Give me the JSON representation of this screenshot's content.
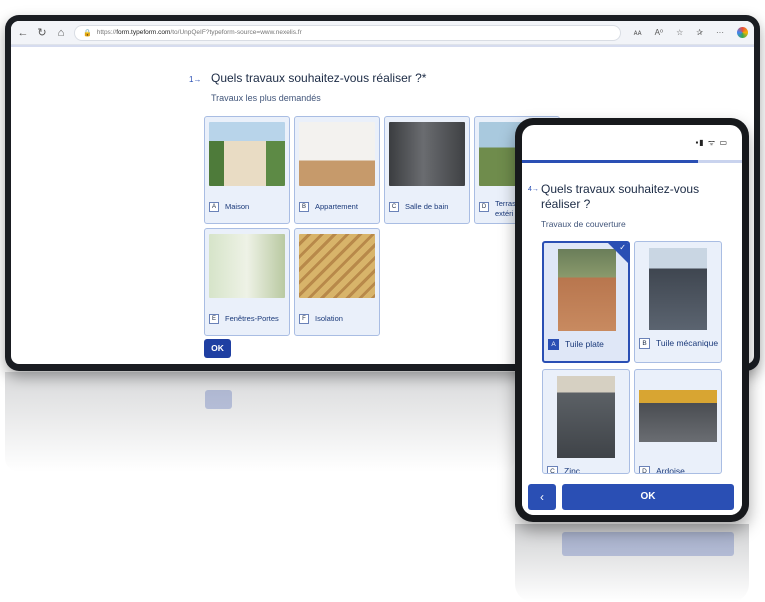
{
  "browser": {
    "url_prefix": "https://",
    "url_host": "form.typeform.com",
    "url_rest": "/to/UnpQeIF?typeform-source=www.nexelis.fr",
    "toolbar_icons": [
      "back-icon",
      "reload-icon",
      "home-icon",
      "lock-icon"
    ],
    "right_icons": [
      "read-aloud-icon",
      "text-icon",
      "star-icon",
      "favorites-icon",
      "more-icon",
      "profile-icon"
    ]
  },
  "desktop": {
    "question_number": "1→",
    "question_title": "Quels travaux souhaitez-vous réaliser ?*",
    "question_subtitle": "Travaux les plus demandés",
    "options": [
      {
        "key": "A",
        "label": "Maison"
      },
      {
        "key": "B",
        "label": "Appartement"
      },
      {
        "key": "C",
        "label": "Salle de bain"
      },
      {
        "key": "D",
        "label": "Terrass extéri"
      },
      {
        "key": "E",
        "label": "Fenêtres-Portes"
      },
      {
        "key": "F",
        "label": "Isolation"
      }
    ],
    "ok_label": "OK"
  },
  "phone": {
    "status_icons": "▪▮ ᯤ ▭",
    "question_number": "4→",
    "question_title": "Quels travaux souhaitez-vous réaliser ?",
    "question_subtitle": "Travaux de couverture",
    "options": [
      {
        "key": "A",
        "label": "Tuile plate",
        "selected": true
      },
      {
        "key": "B",
        "label": "Tuile mécanique",
        "selected": false
      },
      {
        "key": "C",
        "label": "Zinc",
        "selected": false
      },
      {
        "key": "D",
        "label": "Ardoise",
        "selected": false
      }
    ],
    "back_label": "‹",
    "ok_label": "OK",
    "progress": 0.8
  },
  "colors": {
    "accent": "#2a4fb4",
    "card_bg": "#eaf0fa",
    "card_border": "#a9bde3",
    "text": "#1b2a44"
  }
}
